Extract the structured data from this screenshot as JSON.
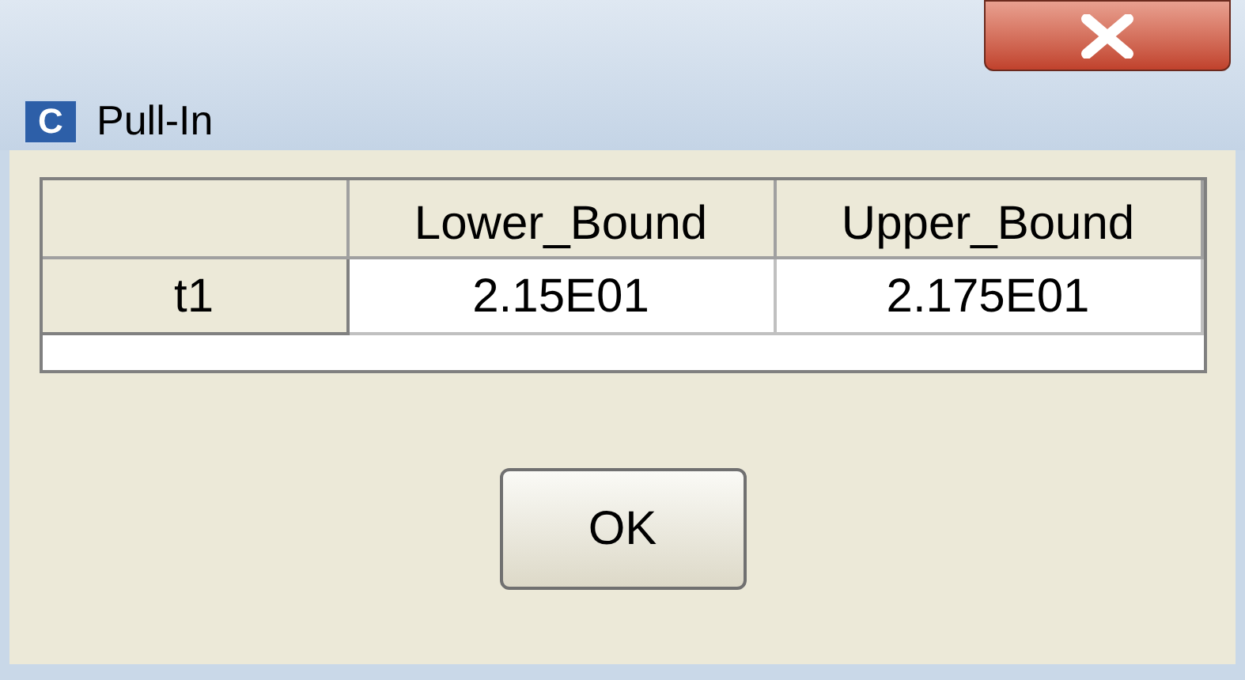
{
  "window": {
    "title": "Pull-In",
    "icon_letter": "C"
  },
  "table": {
    "columns": [
      "Lower_Bound",
      "Upper_Bound"
    ],
    "rows": [
      {
        "header": "t1",
        "cells": [
          "2.15E01",
          "2.175E01"
        ]
      }
    ]
  },
  "buttons": [
    "OK"
  ]
}
